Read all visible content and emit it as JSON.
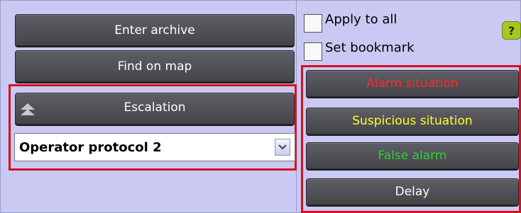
{
  "buttons": {
    "enter_archive": "Enter archive",
    "find_on_map": "Find on map",
    "escalation": "Escalation"
  },
  "protocol_select": {
    "selected": "Operator protocol 2"
  },
  "options": {
    "apply_to_all": "Apply to all",
    "set_bookmark": "Set bookmark"
  },
  "help": {
    "label": "?"
  },
  "actions": {
    "alarm": "Alarm situation",
    "suspicious": "Suspicious situation",
    "false_alarm": "False alarm",
    "delay": "Delay"
  },
  "colors": {
    "background": "#c9c9f3",
    "highlight_border": "#d7101e",
    "alarm_text": "#ff2a2a",
    "suspicious_text": "#ffff2a",
    "false_alarm_text": "#2fd12f"
  },
  "icons": {
    "escalation_arrow": "double-chevron-up-icon",
    "dropdown": "chevron-down-icon",
    "help": "help-icon"
  }
}
